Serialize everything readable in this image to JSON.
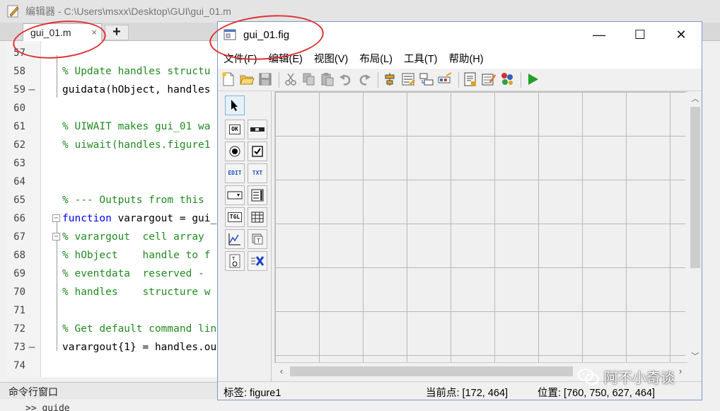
{
  "editor": {
    "title": "编辑器 - C:\\Users\\msxx\\Desktop\\GUI\\gui_01.m",
    "tab_label": "gui_01.m",
    "tab_close": "×",
    "add_tab": "+",
    "lines": [
      {
        "num": "57",
        "marker": "",
        "text": "",
        "kind": "plain"
      },
      {
        "num": "58",
        "marker": "",
        "text": "% Update handles structu",
        "kind": "comment"
      },
      {
        "num": "59",
        "marker": "—",
        "text": "guidata(hObject, handles",
        "kind": "plain"
      },
      {
        "num": "60",
        "marker": "",
        "text": "",
        "kind": "plain"
      },
      {
        "num": "61",
        "marker": "",
        "text": "% UIWAIT makes gui_01 wa",
        "kind": "comment"
      },
      {
        "num": "62",
        "marker": "",
        "text": "% uiwait(handles.figure1",
        "kind": "comment"
      },
      {
        "num": "63",
        "marker": "",
        "text": "",
        "kind": "plain"
      },
      {
        "num": "64",
        "marker": "",
        "text": "",
        "kind": "plain"
      },
      {
        "num": "65",
        "marker": "",
        "text": "% --- Outputs from this",
        "kind": "comment"
      },
      {
        "num": "66",
        "marker": "",
        "text": "function varargout = gui_",
        "kind": "keyword"
      },
      {
        "num": "67",
        "marker": "",
        "text": "% varargout  cell array",
        "kind": "comment"
      },
      {
        "num": "68",
        "marker": "",
        "text": "% hObject    handle to f",
        "kind": "comment"
      },
      {
        "num": "69",
        "marker": "",
        "text": "% eventdata  reserved - ",
        "kind": "comment"
      },
      {
        "num": "70",
        "marker": "",
        "text": "% handles    structure w",
        "kind": "comment"
      },
      {
        "num": "71",
        "marker": "",
        "text": "",
        "kind": "plain"
      },
      {
        "num": "72",
        "marker": "",
        "text": "% Get default command lin",
        "kind": "comment"
      },
      {
        "num": "73",
        "marker": "—",
        "text": "varargout{1} = handles.ou",
        "kind": "plain"
      },
      {
        "num": "74",
        "marker": "",
        "text": "",
        "kind": "plain"
      }
    ],
    "command_window_label": "命令行窗口",
    "command_prompt": ">> guide"
  },
  "guide": {
    "title": "gui_01.fig",
    "window_controls": {
      "minimize": "—",
      "maximize": "☐",
      "close": "✕"
    },
    "menu": [
      "文件(F)",
      "编辑(E)",
      "视图(V)",
      "布局(L)",
      "工具(T)",
      "帮助(H)"
    ],
    "toolbar_icons": [
      "new-file-icon",
      "open-folder-icon",
      "save-icon",
      "cut-icon",
      "copy-icon",
      "paste-icon",
      "undo-icon",
      "redo-icon",
      "align-objects-icon",
      "menu-editor-icon",
      "tab-order-icon",
      "toolbar-editor-icon",
      "m-file-editor-icon",
      "property-inspector-icon",
      "object-browser-icon",
      "run-figure-icon"
    ],
    "palette": [
      {
        "name": "select-tool-icon",
        "text": ""
      },
      {
        "name": "push-button-icon",
        "text": "OK"
      },
      {
        "name": "slider-icon",
        "text": ""
      },
      {
        "name": "radio-button-icon",
        "text": ""
      },
      {
        "name": "checkbox-icon",
        "text": ""
      },
      {
        "name": "edit-text-icon",
        "text": "EDIT"
      },
      {
        "name": "static-text-icon",
        "text": "TXT"
      },
      {
        "name": "popup-menu-icon",
        "text": ""
      },
      {
        "name": "listbox-icon",
        "text": ""
      },
      {
        "name": "toggle-button-icon",
        "text": "TGL"
      },
      {
        "name": "table-icon",
        "text": ""
      },
      {
        "name": "axes-icon",
        "text": ""
      },
      {
        "name": "panel-icon",
        "text": ""
      },
      {
        "name": "button-group-icon",
        "text": ""
      },
      {
        "name": "activex-icon",
        "text": ""
      }
    ],
    "status": {
      "tag": "标签: figure1",
      "current_point": "当前点:  [172, 464]",
      "position": "位置: [760, 750, 627, 464]"
    }
  },
  "watermark": {
    "text": "阿不小奇谈"
  },
  "colors": {
    "annotation_red": "#e03030",
    "comment_green": "#228b22",
    "keyword_blue": "#0000ff",
    "run_green": "#22a02a"
  }
}
